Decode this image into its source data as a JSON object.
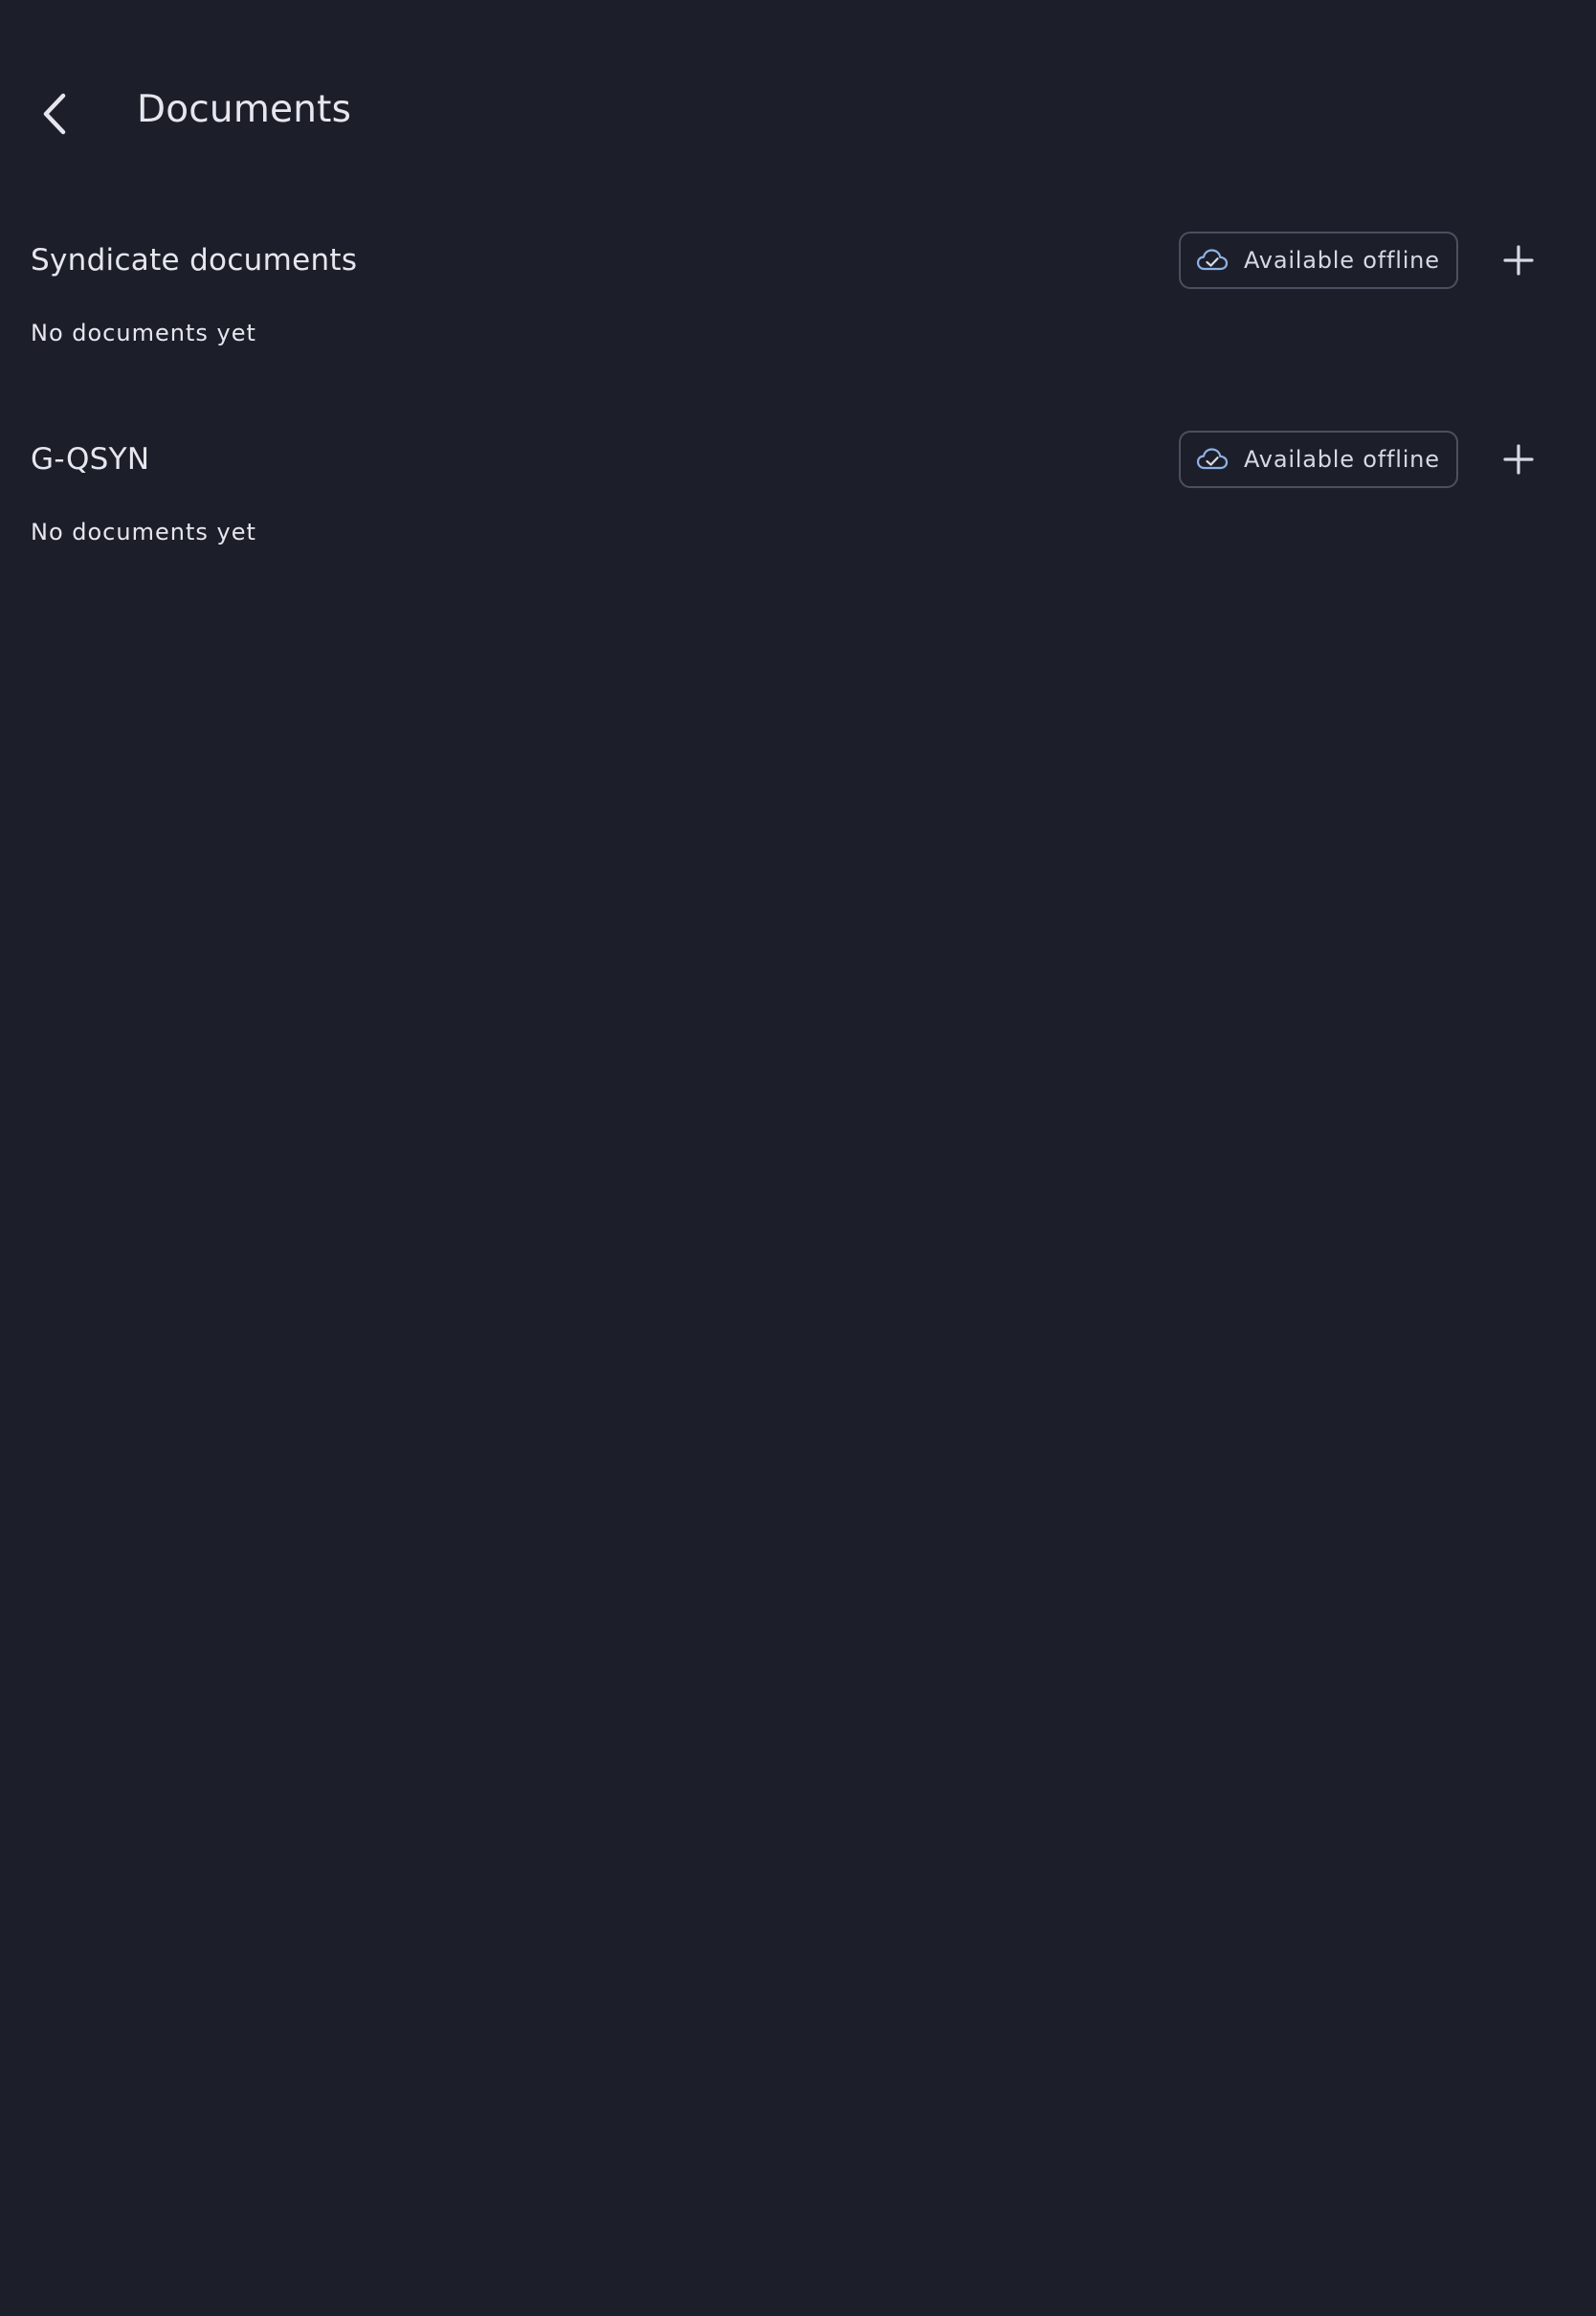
{
  "header": {
    "title": "Documents",
    "back_icon": "chevron-left-icon"
  },
  "sections": [
    {
      "title": "Syndicate documents",
      "offline_label": "Available offline",
      "offline_icon": "cloud-check-icon",
      "add_icon": "plus-icon",
      "empty_text": "No documents yet"
    },
    {
      "title": "G-QSYN",
      "offline_label": "Available offline",
      "offline_icon": "cloud-check-icon",
      "add_icon": "plus-icon",
      "empty_text": "No documents yet"
    }
  ],
  "colors": {
    "background": "#1c1f2a",
    "text": "#e6e7ee",
    "chip_border": "#4b5060",
    "cloud_icon": "#8fb1e6"
  }
}
